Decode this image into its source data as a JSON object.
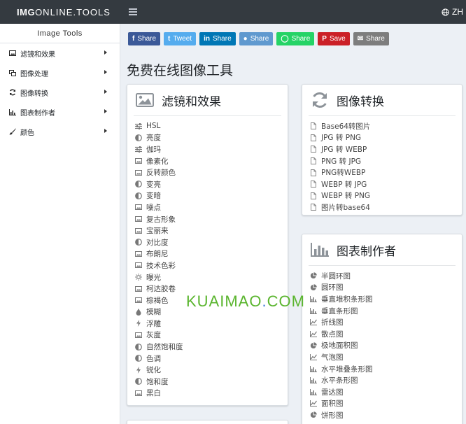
{
  "header": {
    "brand_bold": "IMG",
    "brand_rest": "ONLINE.TOOLS",
    "lang": "ZH"
  },
  "sidebar": {
    "title": "Image Tools",
    "items": [
      {
        "label": "滤镜和效果",
        "icon": "image-icon"
      },
      {
        "label": "图像处理",
        "icon": "clone-icon"
      },
      {
        "label": "图像转换",
        "icon": "sync-icon"
      },
      {
        "label": "图表制作者",
        "icon": "bar-chart-icon"
      },
      {
        "label": "颜色",
        "icon": "brush-icon"
      }
    ]
  },
  "share": {
    "buttons": [
      {
        "label": "Share",
        "icon": "f",
        "color": "#3b5998"
      },
      {
        "label": "Tweet",
        "icon": "t",
        "color": "#55acee"
      },
      {
        "label": "Share",
        "icon": "in",
        "color": "#0077b5"
      },
      {
        "label": "Share",
        "icon": "r",
        "color": "#5f99cf"
      },
      {
        "label": "Share",
        "icon": "w",
        "color": "#25d366"
      },
      {
        "label": "Save",
        "icon": "p",
        "color": "#cb2027"
      },
      {
        "label": "Share",
        "icon": "@",
        "color": "#7d7d7d"
      }
    ]
  },
  "main": {
    "title": "免费在线图像工具"
  },
  "cards": {
    "filters": {
      "title": "滤镜和效果",
      "links": [
        {
          "label": "HSL",
          "icon": "sliders-icon"
        },
        {
          "label": "亮度",
          "icon": "adjust-icon"
        },
        {
          "label": "伽玛",
          "icon": "sliders-icon"
        },
        {
          "label": "像素化",
          "icon": "image-icon"
        },
        {
          "label": "反转颜色",
          "icon": "image-icon"
        },
        {
          "label": "变亮",
          "icon": "adjust-icon"
        },
        {
          "label": "变暗",
          "icon": "adjust-icon"
        },
        {
          "label": "噪点",
          "icon": "image-icon"
        },
        {
          "label": "复古形象",
          "icon": "image-icon"
        },
        {
          "label": "宝丽来",
          "icon": "image-icon"
        },
        {
          "label": "对比度",
          "icon": "adjust-icon"
        },
        {
          "label": "布朗尼",
          "icon": "image-icon"
        },
        {
          "label": "技术色彩",
          "icon": "image-icon"
        },
        {
          "label": "曝光",
          "icon": "sun-icon"
        },
        {
          "label": "柯达胶卷",
          "icon": "image-icon"
        },
        {
          "label": "棕褐色",
          "icon": "image-icon"
        },
        {
          "label": "模糊",
          "icon": "drop-icon"
        },
        {
          "label": "浮雕",
          "icon": "bolt-icon"
        },
        {
          "label": "灰度",
          "icon": "image-icon"
        },
        {
          "label": "自然饱和度",
          "icon": "adjust-icon"
        },
        {
          "label": "色调",
          "icon": "adjust-icon"
        },
        {
          "label": "锐化",
          "icon": "bolt-icon"
        },
        {
          "label": "饱和度",
          "icon": "adjust-icon"
        },
        {
          "label": "黑白",
          "icon": "image-icon"
        }
      ]
    },
    "convert": {
      "title": "图像转换",
      "links": [
        {
          "label": "Base64转图片"
        },
        {
          "label": "JPG 转 PNG"
        },
        {
          "label": "JPG 转 WEBP"
        },
        {
          "label": "PNG 转 JPG"
        },
        {
          "label": "PNG转WEBP"
        },
        {
          "label": "WEBP 转 JPG"
        },
        {
          "label": "WEBP 转 PNG"
        },
        {
          "label": "图片转base64"
        }
      ]
    },
    "charts": {
      "title": "图表制作者",
      "links": [
        {
          "label": "半圆环图",
          "icon": "pie-icon"
        },
        {
          "label": "圆环图",
          "icon": "pie-icon"
        },
        {
          "label": "垂直堆积条形图",
          "icon": "bar-icon"
        },
        {
          "label": "垂直条形图",
          "icon": "bar-icon"
        },
        {
          "label": "折线图",
          "icon": "line-icon"
        },
        {
          "label": "散点图",
          "icon": "line-icon"
        },
        {
          "label": "极地面积图",
          "icon": "pie-icon"
        },
        {
          "label": "气泡图",
          "icon": "line-icon"
        },
        {
          "label": "水平堆叠条形图",
          "icon": "bar-icon"
        },
        {
          "label": "水平条形图",
          "icon": "bar-icon"
        },
        {
          "label": "雷达图",
          "icon": "bar-icon"
        },
        {
          "label": "面积图",
          "icon": "line-icon"
        },
        {
          "label": "饼形图",
          "icon": "pie-icon"
        }
      ]
    }
  },
  "watermark": {
    "text": "KUAIMAO",
    "dot": ".",
    "tld": "COM"
  }
}
